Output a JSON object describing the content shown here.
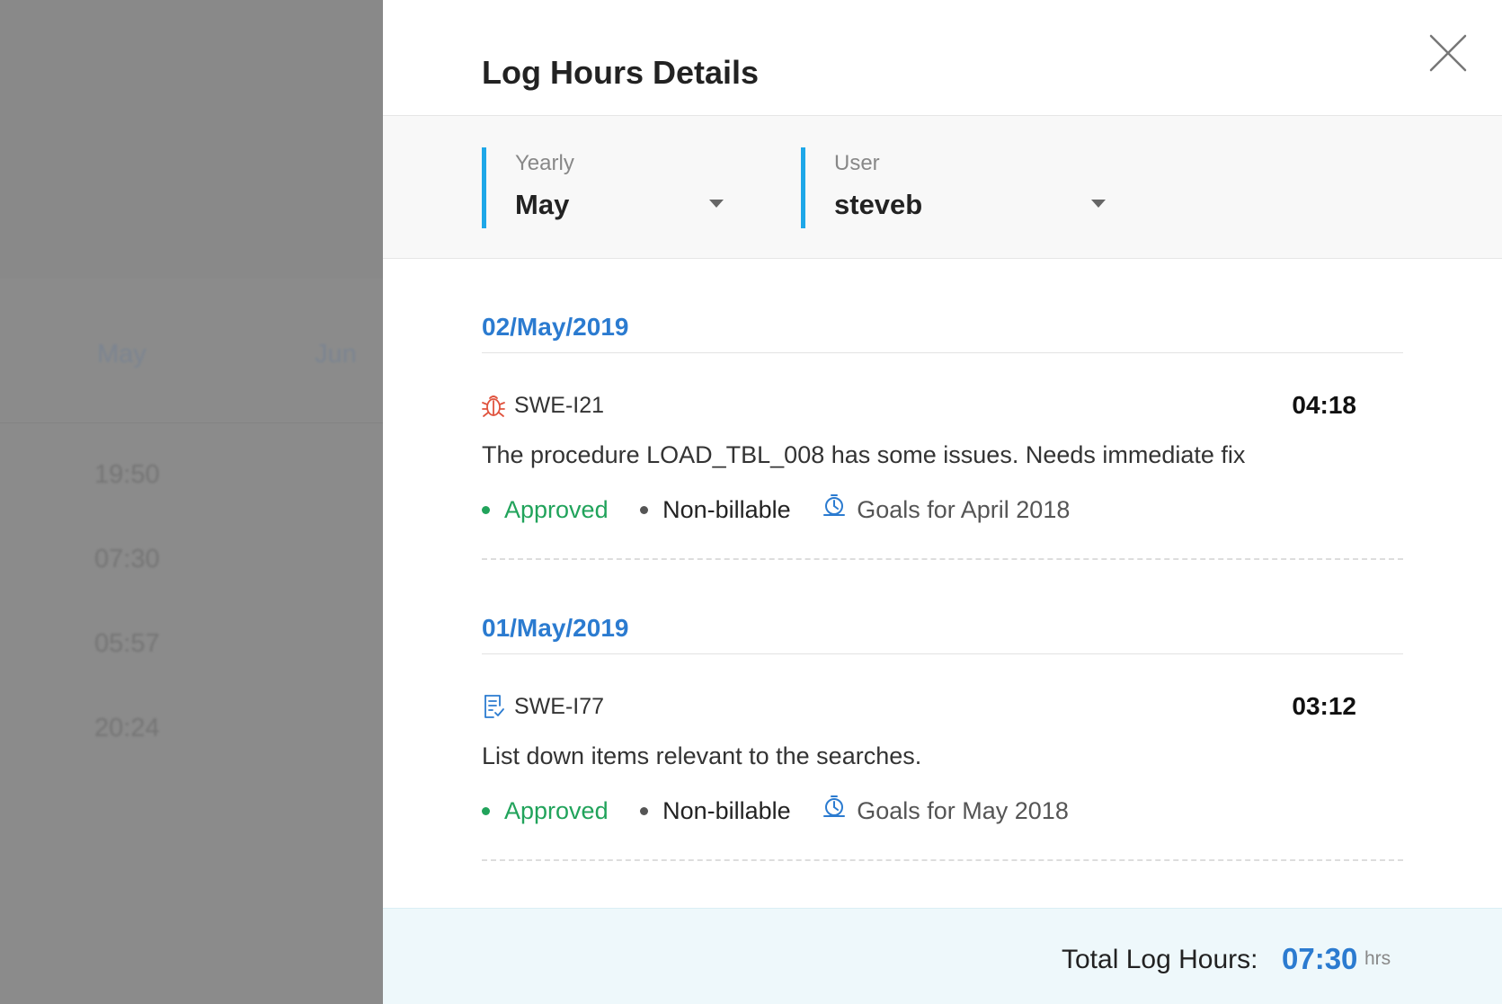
{
  "background": {
    "months": [
      "May",
      "Jun"
    ],
    "times": [
      "19:50",
      "07:30",
      "05:57",
      "20:24"
    ]
  },
  "drawer": {
    "title": "Log Hours Details",
    "close_icon": "close-icon"
  },
  "filters": {
    "period": {
      "label": "Yearly",
      "value": "May"
    },
    "user": {
      "label": "User",
      "value": "steveb"
    }
  },
  "groups": [
    {
      "date": "02/May/2019",
      "entries": [
        {
          "icon": "bug-icon",
          "id": "SWE-I21",
          "hours": "04:18",
          "description": "The procedure LOAD_TBL_008 has some issues. Needs immediate fix",
          "status": "Approved",
          "billing": "Non-billable",
          "goal": "Goals for April 2018"
        }
      ]
    },
    {
      "date": "01/May/2019",
      "entries": [
        {
          "icon": "task-icon",
          "id": "SWE-I77",
          "hours": "03:12",
          "description": "List down items relevant to the searches.",
          "status": "Approved",
          "billing": "Non-billable",
          "goal": "Goals for May 2018"
        }
      ]
    }
  ],
  "footer": {
    "label": "Total Log Hours:",
    "value": "07:30",
    "unit": "hrs"
  },
  "colors": {
    "accent": "#2b7bd0",
    "filter_bar_accent": "#1ea7e8",
    "approved": "#21a35b",
    "bug": "#e0533e"
  }
}
